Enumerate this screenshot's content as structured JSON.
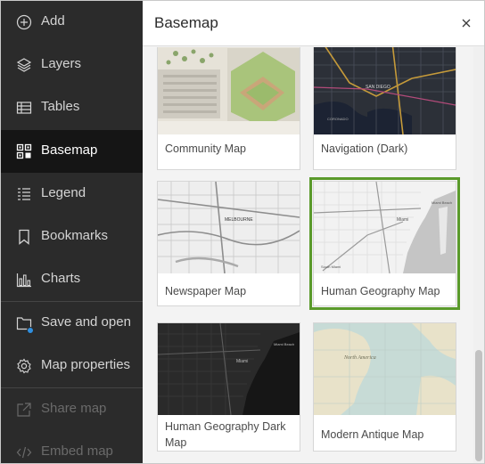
{
  "sidebar": {
    "items": [
      {
        "label": "Add",
        "icon": "add-circle-icon"
      },
      {
        "label": "Layers",
        "icon": "layers-icon"
      },
      {
        "label": "Tables",
        "icon": "table-icon"
      },
      {
        "label": "Basemap",
        "icon": "basemap-icon"
      },
      {
        "label": "Legend",
        "icon": "legend-icon"
      },
      {
        "label": "Bookmarks",
        "icon": "bookmark-icon"
      },
      {
        "label": "Charts",
        "icon": "chart-icon"
      },
      {
        "label": "Save and open",
        "icon": "folder-icon"
      },
      {
        "label": "Map properties",
        "icon": "gear-icon"
      },
      {
        "label": "Share map",
        "icon": "share-icon"
      },
      {
        "label": "Embed map",
        "icon": "code-icon"
      }
    ],
    "active": "Basemap",
    "disabled": [
      "Share map",
      "Embed map"
    ]
  },
  "panel": {
    "title": "Basemap",
    "close_icon": "close-icon"
  },
  "basemaps": [
    {
      "label": "Community Map"
    },
    {
      "label": "Navigation (Dark)"
    },
    {
      "label": "Newspaper Map"
    },
    {
      "label": "Human Geography Map",
      "selected": true
    },
    {
      "label": "Human Geography Dark Map"
    },
    {
      "label": "Modern Antique Map"
    }
  ],
  "map_text": {
    "nav_dark_city": "SAN DIEGO",
    "nav_dark_place": "CORONADO",
    "newspaper_city": "MELBOURNE",
    "hg_city": "Miami",
    "hg_beach": "Miami Beach",
    "hg_south": "South Miami",
    "hgd_city": "Miami",
    "hgd_beach": "Miami Beach",
    "antique_place": "North America"
  },
  "colors": {
    "sidebar_bg": "#2b2b2b",
    "active_bg": "#151515",
    "selected_outline": "#5a9a2b",
    "badge": "#2f8fe0"
  }
}
